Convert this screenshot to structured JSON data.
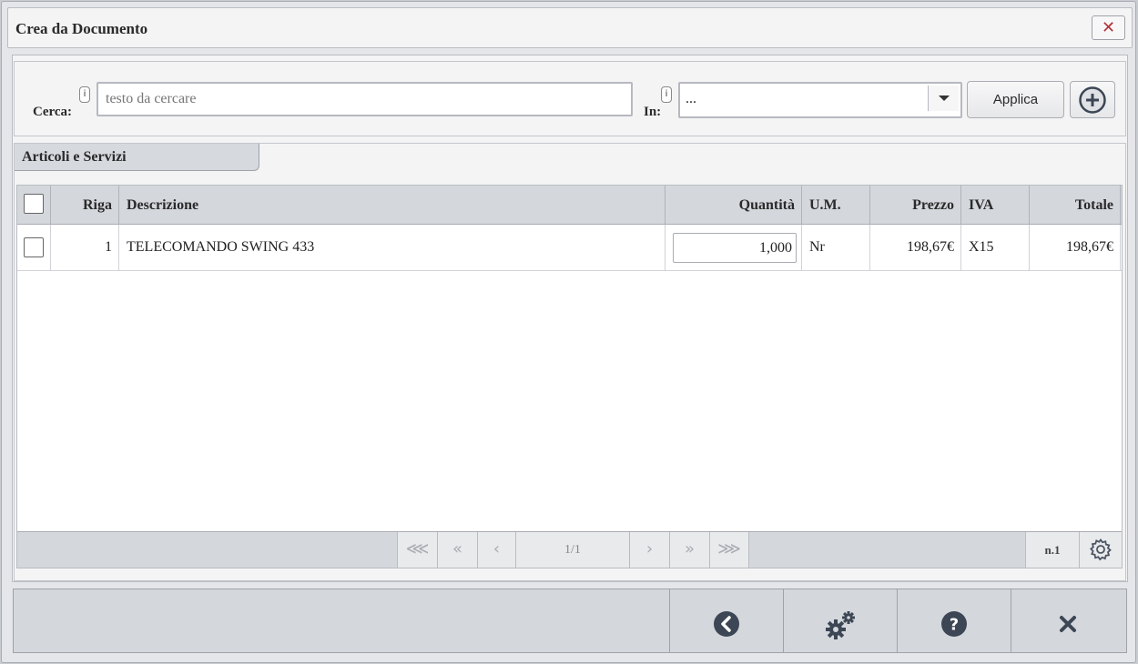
{
  "window": {
    "title": "Crea da Documento"
  },
  "search": {
    "cerca_label": "Cerca:",
    "in_label": "In:",
    "info": "i",
    "placeholder": "testo da cercare",
    "in_value": "...",
    "apply_label": "Applica"
  },
  "panel": {
    "title": "Articoli e Servizi"
  },
  "table": {
    "columns": [
      "Riga",
      "Descrizione",
      "Quantità",
      "U.M.",
      "Prezzo",
      "IVA",
      "Totale"
    ],
    "rows": [
      {
        "riga": "1",
        "descrizione": "TELECOMANDO SWING 433",
        "quantita": "1,000",
        "um": "Nr",
        "prezzo": "198,67€",
        "iva": "X15",
        "totale": "198,67€"
      }
    ]
  },
  "pager": {
    "first": "⋘",
    "prev_page": "«",
    "prev": "‹",
    "page": "1/1",
    "next": "›",
    "next_page": "»",
    "last": "⋙",
    "count": "n.1"
  },
  "colors": {
    "accent": "#3c4654",
    "header_bg": "#d4d7dc",
    "close_red": "#b0333a"
  },
  "icons": [
    "close-icon",
    "info-icon",
    "dropdown-arrow-icon",
    "add-circle-icon",
    "gear-icon",
    "back-icon",
    "gears-icon",
    "help-icon",
    "close-icon"
  ]
}
